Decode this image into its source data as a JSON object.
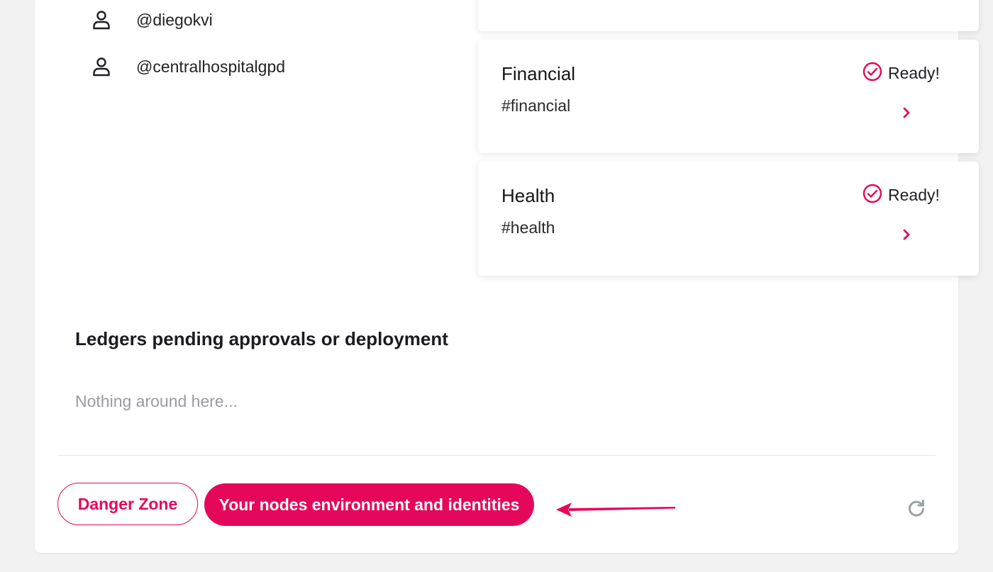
{
  "members": [
    {
      "handle": "@diegokvi",
      "icon": "user-icon"
    },
    {
      "handle": "@centralhospitalgpd",
      "icon": "user-icon"
    }
  ],
  "ledgers": [
    {
      "title": "Financial",
      "tag": "#financial",
      "status": "Ready!",
      "status_icon": "check-circle-icon",
      "action_icon": "chevron-right-icon"
    },
    {
      "title": "Health",
      "tag": "#health",
      "status": "Ready!",
      "status_icon": "check-circle-icon",
      "action_icon": "chevron-right-icon"
    }
  ],
  "pending": {
    "title": "Ledgers pending approvals or deployment",
    "empty_text": "Nothing around here..."
  },
  "footer": {
    "danger_label": "Danger Zone",
    "nodes_label": "Your nodes environment and identities",
    "refresh_icon": "refresh-icon",
    "annotation_icon": "arrow-left-icon"
  },
  "colors": {
    "accent": "#e5075a",
    "background": "#f2f2f3",
    "muted_text": "#9a9aa2"
  }
}
